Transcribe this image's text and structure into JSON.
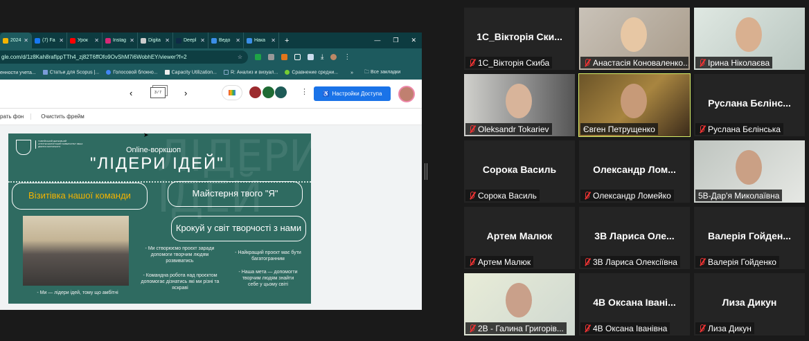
{
  "browser": {
    "tabs": [
      {
        "label": "2024",
        "color": "#f5b400"
      },
      {
        "label": "(7) Fa",
        "color": "#1877f2"
      },
      {
        "label": "Урок",
        "color": "#ff0000"
      },
      {
        "label": "Instag",
        "color": "#d62976"
      },
      {
        "label": "Digita",
        "color": "#ccc"
      },
      {
        "label": "Deepl",
        "color": "#0f2b46"
      },
      {
        "label": "Ведо",
        "color": "#3b8ee8"
      },
      {
        "label": "Нака",
        "color": "#3b8ee8"
      }
    ],
    "new_tab": "+",
    "url": "gle.com/d/1z8Kah8rafIppTTh4_zj82T6ffOfo9OvShM7i6WobhEY/viewer?f=2",
    "bookmarks": [
      "енности учета...",
      "Статьи для Scopus |...",
      "Голосовой блокно...",
      "Capacity Utilization...",
      "R: Анализ и визуал...",
      "Сравнение средни..."
    ],
    "bookmarks_more": "»",
    "all_bookmarks": "Все закладки"
  },
  "drive": {
    "page_indicator": "3 / 7",
    "access_button": "Настройки Доступа",
    "sub_items": [
      "рать фон",
      "Очистить фрейм"
    ]
  },
  "slide": {
    "org": "ТАВРІЙСЬКИЙ ДЕРЖАВНИЙ АГРОТЕХНОЛОГІЧНИЙ УНІВЕРСИТЕТ ІМЕНІ ДМИТРА МОТОРНОГО",
    "subtitle": "Online-воркшоп",
    "title": "\"ЛІДЕРИ ІДЕЙ\"",
    "watermark": "ЛІДЕРИ ІДЕЙ",
    "pill1": "Візитівка нашої команди",
    "pill2": "Майстерня твого  \"Я\"",
    "pill3": "Крокуй у світ творчості з нами",
    "caption": "- Ми — лідери ідей, тому що амбітні",
    "point1": "- Ми створюємо проєкт заради допомоги творчим людям розвиватись",
    "point2": "- Командна робота над проєктом допомогає дізнатись які ми різні та яскраві",
    "point3": "- Найкращий проєкт має бути багатогранним",
    "point4": "- Наша мета — допомогти творчим людям знайти себе у цьому світі"
  },
  "participants": [
    {
      "big": "1С_Вікторія Ски...",
      "name": "1С_Вікторія Скиба",
      "video": false,
      "muted": true
    },
    {
      "big": "",
      "name": "Анастасія Коноваленко...",
      "video": true,
      "muted": true
    },
    {
      "big": "",
      "name": "Ірина Ніколаєва",
      "video": true,
      "muted": true
    },
    {
      "big": "",
      "name": "Oleksandr Tokariev",
      "video": true,
      "muted": true
    },
    {
      "big": "",
      "name": "Євген Петрущенко",
      "video": true,
      "muted": false,
      "speaking": true
    },
    {
      "big": "Руслана Бєлінс...",
      "name": "Руслана Бєлінська",
      "video": false,
      "muted": true
    },
    {
      "big": "Сорока Василь",
      "name": "Сорока Василь",
      "video": false,
      "muted": true
    },
    {
      "big": "Олександр Лом...",
      "name": "Олександр Ломейко",
      "video": false,
      "muted": true
    },
    {
      "big": "",
      "name": "5В-Дар'я Миколаївна",
      "video": true,
      "muted": false
    },
    {
      "big": "Артем Малюк",
      "name": "Артем Малюк",
      "video": false,
      "muted": true
    },
    {
      "big": "3В Лариса Оле...",
      "name": "3В Лариса Олексіївна",
      "video": false,
      "muted": true
    },
    {
      "big": "Валерія Гойден...",
      "name": "Валерія Гойденко",
      "video": false,
      "muted": true
    },
    {
      "big": "",
      "name": "2В - Галина Григорів...",
      "video": true,
      "muted": true
    },
    {
      "big": "4В Оксана Івані...",
      "name": "4В Оксана Іванівна",
      "video": false,
      "muted": true
    },
    {
      "big": "Лиза Дикун",
      "name": "Лиза Дикун",
      "video": false,
      "muted": true
    }
  ]
}
